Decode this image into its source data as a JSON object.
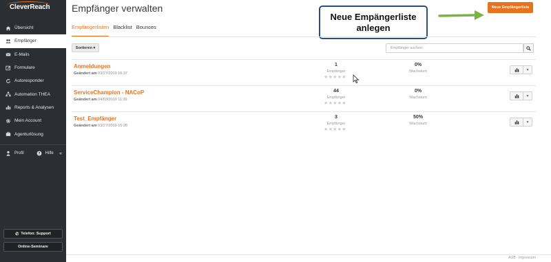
{
  "brand": {
    "name": "CleverReach",
    "accent": "#e8731f"
  },
  "sidebar": {
    "items": [
      {
        "label": "Übersicht",
        "icon": "home-icon",
        "active": false
      },
      {
        "label": "Empfänger",
        "icon": "users-icon",
        "active": true
      },
      {
        "label": "E-Mails",
        "icon": "envelope-icon",
        "active": false
      },
      {
        "label": "Formulare",
        "icon": "form-edit-icon",
        "active": false
      },
      {
        "label": "Autoresponder",
        "icon": "refresh-icon",
        "active": false
      },
      {
        "label": "Automation THEA",
        "icon": "sitemap-icon",
        "active": false
      },
      {
        "label": "Reports & Analysen",
        "icon": "bar-chart-icon",
        "active": false
      },
      {
        "label": "Mein Account",
        "icon": "gear-icon",
        "active": false
      },
      {
        "label": "Agenturlösung",
        "icon": "briefcase-icon",
        "active": false
      }
    ],
    "profile_label": "Profil",
    "help_label": "Hilfe",
    "collapse_glyph": "«",
    "phone_support_label": "Telefon: Support",
    "seminars_label": "Online-Seminare"
  },
  "header": {
    "title": "Empfänger verwalten",
    "new_list_button": "Neue Empfängerliste"
  },
  "callout": {
    "line1": "Neue Empängerliste",
    "line2": "anlegen"
  },
  "tabs": [
    {
      "label": "Empfängerlisten",
      "active": true
    },
    {
      "label": "Blacklist",
      "active": false
    },
    {
      "label": "Bounces",
      "active": false
    }
  ],
  "toolbar": {
    "sort_label": "Sortieren ▾",
    "search_placeholder": "Empfänger suchen"
  },
  "lists": [
    {
      "name": "Anmeldungen",
      "changed_label": "Geändert am",
      "changed_date": "03/27/2019 16:37",
      "count": "1",
      "count_label": "Empfänger",
      "growth": "0%",
      "growth_label": "Wachstum",
      "stars": "★★★★★"
    },
    {
      "name": "ServiceChampion - NACoP",
      "changed_label": "Geändert am",
      "changed_date": "04/03/2019 11:39",
      "count": "44",
      "count_label": "Empfänger",
      "growth": "0%",
      "growth_label": "Wachstum",
      "stars": "★★★★★"
    },
    {
      "name": "Test_Empfänger",
      "changed_label": "Geändert am",
      "changed_date": "03/27/2019 15:28",
      "count": "3",
      "count_label": "Empfänger",
      "growth": "50%",
      "growth_label": "Wachstum",
      "stars": "★★★★★"
    }
  ],
  "footer": {
    "text": "AGB · Impressum"
  }
}
